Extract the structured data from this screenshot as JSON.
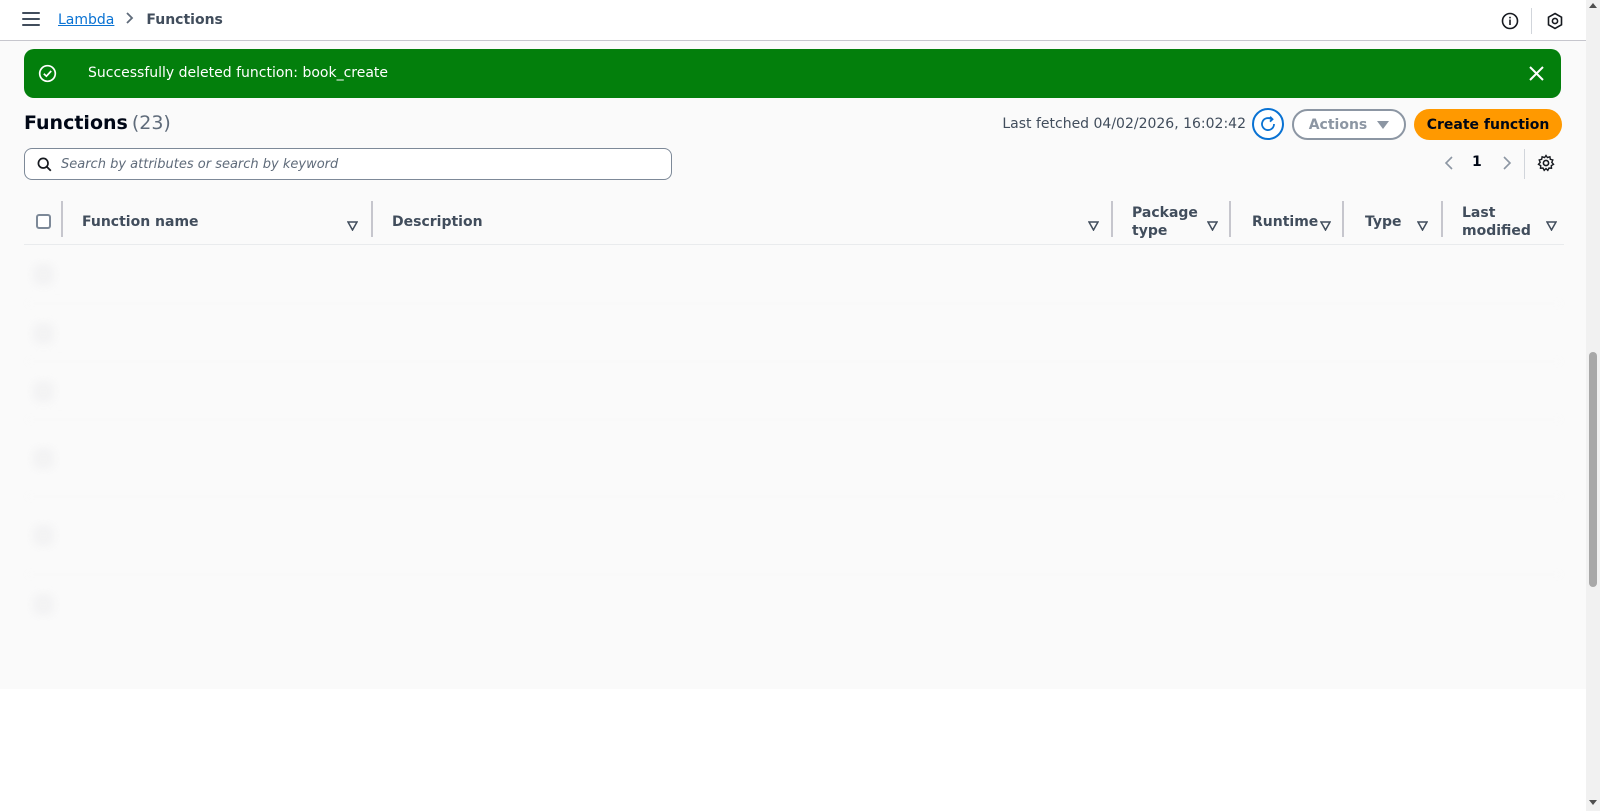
{
  "breadcrumb": {
    "parent": "Lambda",
    "current": "Functions"
  },
  "flash": {
    "message": "Successfully deleted function: book_create",
    "color": "#037f0c"
  },
  "header": {
    "title": "Functions",
    "count": "(23)"
  },
  "last_fetched": "Last fetched 04/02/2026, 16:02:42",
  "buttons": {
    "actions": "Actions",
    "create": "Create function"
  },
  "search": {
    "placeholder": "Search by attributes or search by keyword",
    "value": ""
  },
  "pagination": {
    "current_page": "1"
  },
  "table": {
    "columns": [
      "Function name",
      "Description",
      "Package type",
      "Runtime",
      "Type",
      "Last modified"
    ],
    "rows": [
      {
        "name": "",
        "description": "",
        "package": "",
        "runtime": "",
        "type": "",
        "modified": ""
      },
      {
        "name": "",
        "description": "",
        "package": "",
        "runtime": "",
        "type": "",
        "modified": ""
      },
      {
        "name": "",
        "description": "",
        "package": "",
        "runtime": "",
        "type": "",
        "modified": ""
      },
      {
        "name": "",
        "description": "",
        "package": "",
        "runtime": "",
        "type": "",
        "modified": ""
      },
      {
        "name": "",
        "description": "",
        "package": "",
        "runtime": "",
        "type": "",
        "modified": ""
      },
      {
        "name": "",
        "description": "",
        "package": "",
        "runtime": "",
        "type": "",
        "modified": ""
      }
    ]
  },
  "colors": {
    "primary": "#ff9900",
    "link": "#0972d3",
    "success": "#037f0c"
  }
}
